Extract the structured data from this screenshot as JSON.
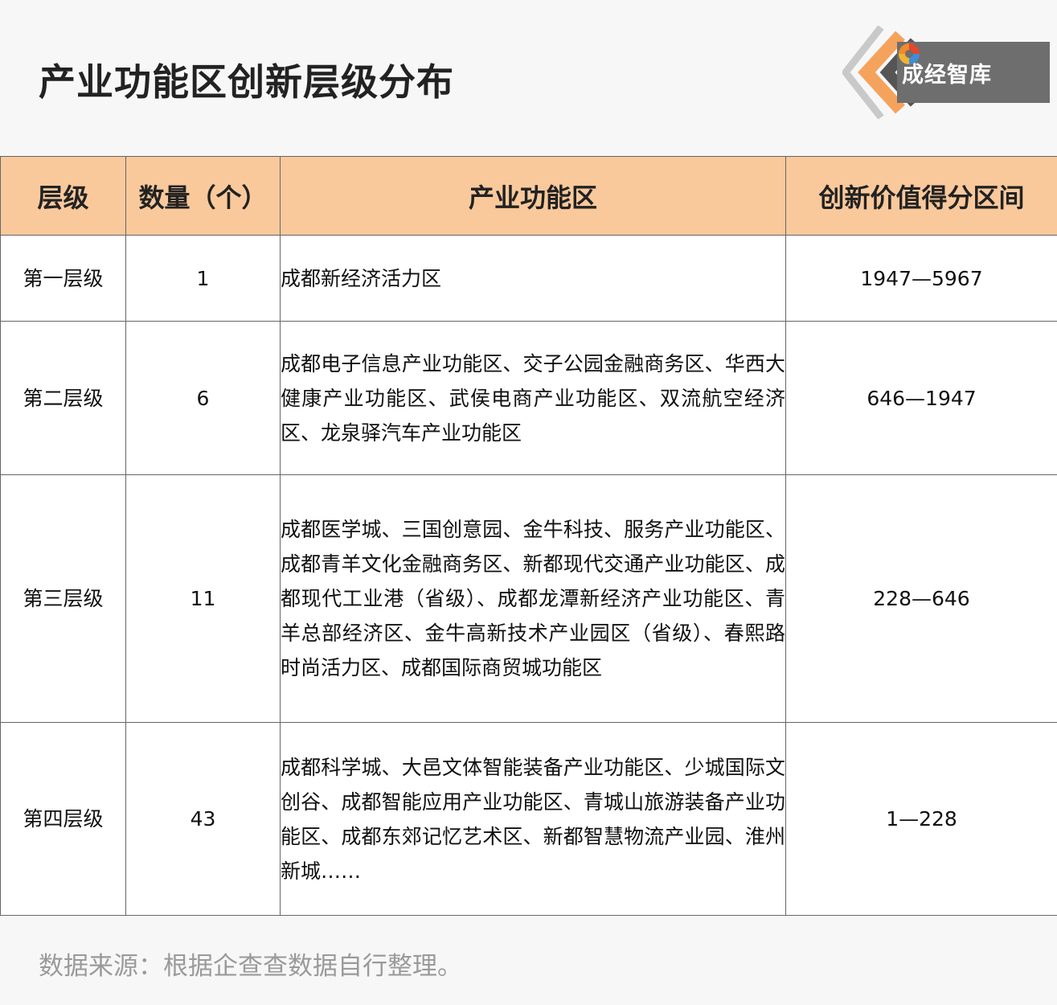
{
  "header": {
    "title": "产业功能区创新层级分布"
  },
  "brand": {
    "name": "成经智库",
    "colors": {
      "accent": "#f5a35c",
      "box": "#6e6e6e",
      "chevron": "#c9c9c9"
    },
    "logo_icon": "swirl-logo-icon"
  },
  "table": {
    "columns": [
      "层级",
      "数量（个）",
      "产业功能区",
      "创新价值得分区间"
    ],
    "header_color": "#f9c99c",
    "rows": [
      {
        "level": "第一层级",
        "count": "1",
        "zones": "成都新经济活力区",
        "range": "1947—5967"
      },
      {
        "level": "第二层级",
        "count": "6",
        "zones": "成都电子信息产业功能区、交子公园金融商务区、华西大健康产业功能区、武侯电商产业功能区、双流航空经济区、龙泉驿汽车产业功能区",
        "range": "646—1947"
      },
      {
        "level": "第三层级",
        "count": "11",
        "zones": "成都医学城、三国创意园、金牛科技、服务产业功能区、成都青羊文化金融商务区、新都现代交通产业功能区、成都现代工业港（省级）、成都龙潭新经济产业功能区、青羊总部经济区、金牛高新技术产业园区（省级）、春熙路时尚活力区、成都国际商贸城功能区",
        "range": "228—646"
      },
      {
        "level": "第四层级",
        "count": "43",
        "zones": "成都科学城、大邑文体智能装备产业功能区、少城国际文创谷、成都智能应用产业功能区、青城山旅游装备产业功能区、成都东郊记忆艺术区、新都智慧物流产业园、淮州新城……",
        "range": "1—228"
      }
    ]
  },
  "footer": {
    "source": "数据来源：根据企查查数据自行整理。"
  }
}
